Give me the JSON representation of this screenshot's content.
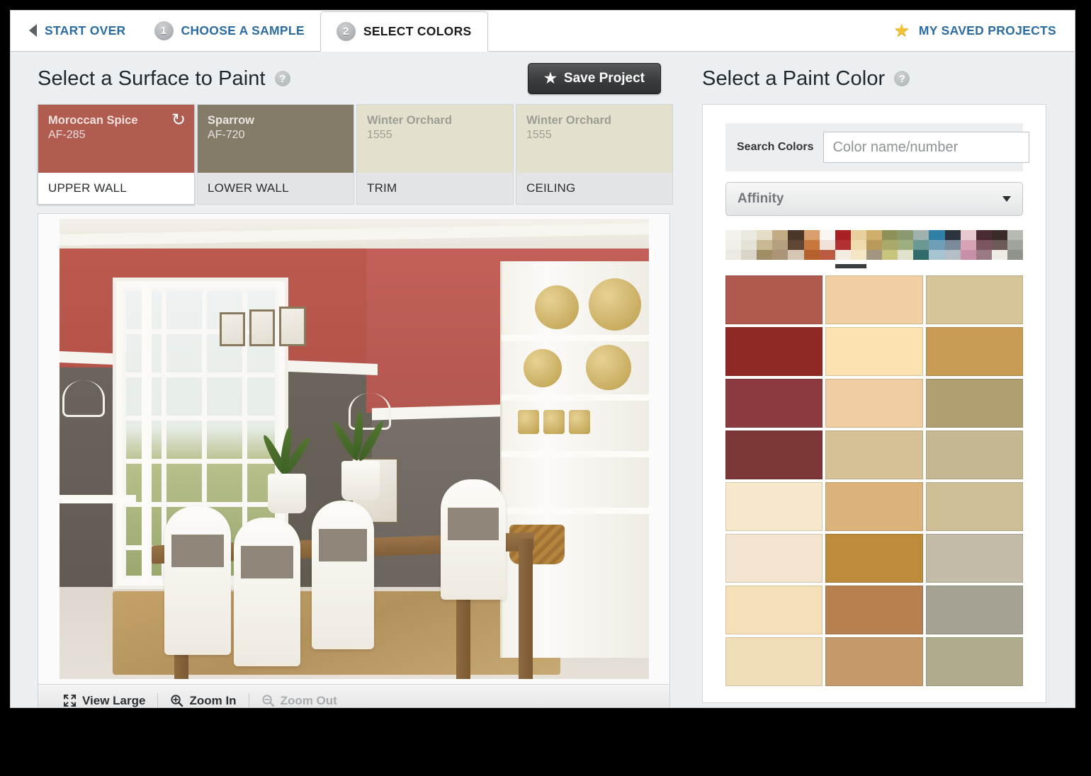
{
  "topnav": {
    "back_icon": "back-triangle-icon",
    "start_over": "START OVER",
    "step1_num": "1",
    "step1_label": "CHOOSE A SAMPLE",
    "step2_num": "2",
    "step2_label": "SELECT COLORS",
    "saved_projects": "MY SAVED PROJECTS",
    "link_color": "#2b6ca3"
  },
  "left": {
    "title": "Select a Surface to Paint",
    "help": "?",
    "save_label": "Save Project",
    "surfaces": [
      {
        "name": "Moroccan Spice",
        "number": "AF-285",
        "label": "UPPER WALL",
        "color": "#b05c50",
        "selected": true,
        "light": false,
        "undo": "↺"
      },
      {
        "name": "Sparrow",
        "number": "AF-720",
        "label": "LOWER WALL",
        "color": "#847b69",
        "selected": false,
        "light": false,
        "undo": ""
      },
      {
        "name": "Winter Orchard",
        "number": "1555",
        "label": "TRIM",
        "color": "#e3e1ce",
        "selected": false,
        "light": true,
        "undo": ""
      },
      {
        "name": "Winter Orchard",
        "number": "1555",
        "label": "CEILING",
        "color": "#e3e1ce",
        "selected": false,
        "light": true,
        "undo": ""
      }
    ],
    "toolbar": {
      "view_large": "View Large",
      "zoom_in": "Zoom In",
      "zoom_out": "Zoom Out",
      "view_large_icon": "expand-arrows-icon",
      "zoom_in_icon": "magnifier-plus-icon",
      "zoom_out_icon": "magnifier-minus-icon",
      "zoom_out_disabled": true
    }
  },
  "right": {
    "title": "Select a Paint Color",
    "help": "?",
    "search_label": "Search Colors",
    "search_value": "",
    "search_placeholder": "Color name/number",
    "collection_selected": "Affinity",
    "palette_strip": [
      [
        "#f3f2ed",
        "#f0efe9",
        "#eceae2"
      ],
      [
        "#ece9e0",
        "#e4e1d6",
        "#d9d5c8"
      ],
      [
        "#e6ddc8",
        "#c9b894",
        "#a08d63"
      ],
      [
        "#c3ab86",
        "#b49f7e",
        "#ab9478"
      ],
      [
        "#4a372a",
        "#5e4633",
        "#d6c7b4"
      ],
      [
        "#d99e6c",
        "#c9763f",
        "#b45f2c"
      ],
      [
        "#faf7f3",
        "#f0e2d9",
        "#bd5a42"
      ],
      [
        "#a81f24",
        "#b03034",
        "#f2ece1"
      ],
      [
        "#e8cf9e",
        "#f0dbac",
        "#f5e6c6"
      ],
      [
        "#cfb06a",
        "#b79a5c",
        "#a39680"
      ],
      [
        "#8d9158",
        "#a9a96a",
        "#c8c47e"
      ],
      [
        "#8b9a6e",
        "#9fae7e",
        "#dfe3cd"
      ],
      [
        "#9fb2ad",
        "#6c9892",
        "#2f6b6a"
      ],
      [
        "#2e81a5",
        "#6e9fb6",
        "#a8c3d1"
      ],
      [
        "#2c3440",
        "#7a8a9b",
        "#b5bec7"
      ],
      [
        "#e8c8cf",
        "#d8a3b5",
        "#c98fa8"
      ],
      [
        "#4a2b33",
        "#7b5560",
        "#9a7a84"
      ],
      [
        "#3a2a28",
        "#6b5a55",
        "#efece6"
      ],
      [
        "#b7bab2",
        "#9fa49c",
        "#8e948c"
      ]
    ],
    "strip_indicator_index": 7,
    "swatches": [
      [
        "#b0594e",
        "#f0cfa4",
        "#d7c499"
      ],
      [
        "#8e2824",
        "#fae3b1",
        "#c79b54"
      ],
      [
        "#8b3a40",
        "#efcda0",
        "#b0a071"
      ],
      [
        "#7c3636",
        "#d6c197",
        "#c6b793"
      ],
      [
        "#f7e7cb",
        "#dbb27a",
        "#cdbe96"
      ],
      [
        "#f3e4cf",
        "#bd8b3c",
        "#c2bba7"
      ],
      [
        "#f5dfb6",
        "#b6804f",
        "#a5a294"
      ],
      [
        "#f2ddb9",
        "#c59a68",
        "#aeac8d"
      ]
    ]
  }
}
